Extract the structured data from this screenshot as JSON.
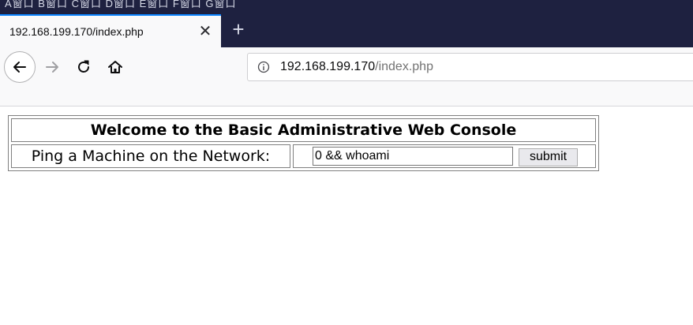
{
  "browser": {
    "menu_fragment": "A窗口  B窗口  C窗口  D窗口  E窗口  F窗口  G窗口",
    "tab": {
      "title": "192.168.199.170/index.php",
      "close_glyph": "✕"
    },
    "new_tab_glyph": "+",
    "url": {
      "host": "192.168.199.170",
      "path": "/index.php"
    },
    "icons": [
      "back-arrow-icon",
      "forward-arrow-icon",
      "reload-icon",
      "home-icon",
      "info-icon"
    ],
    "colors": {
      "tab_accent": "#0a84ff",
      "tabstrip_bg": "#1e2140",
      "toolbar_bg": "#f9f9fa"
    }
  },
  "page": {
    "heading": "Welcome to the Basic Administrative Web Console",
    "ping_label": "Ping a Machine on the Network:",
    "ping_input_value": "0 && whoami",
    "submit_label": "submit"
  }
}
